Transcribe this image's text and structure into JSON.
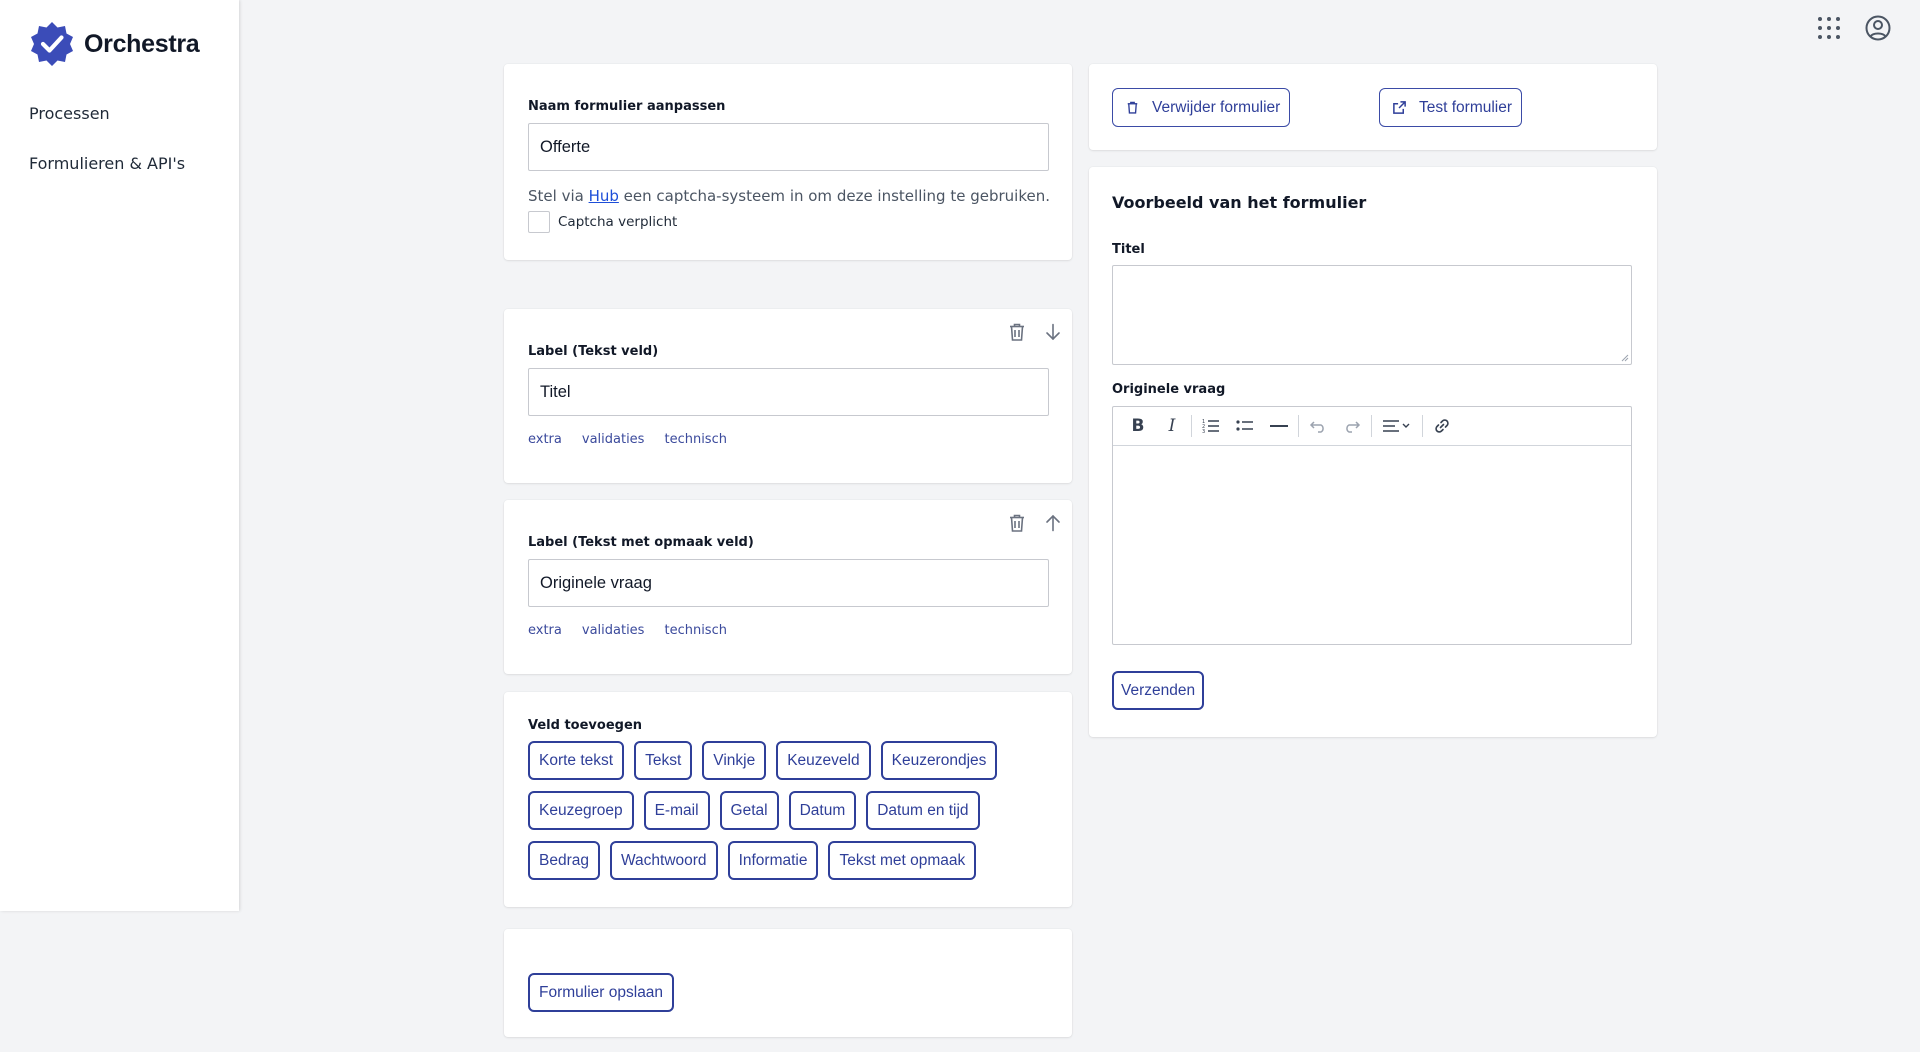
{
  "app": {
    "name": "Orchestra",
    "brand_color": "#3b4cb8"
  },
  "sidebar": {
    "items": [
      {
        "label": "Processen"
      },
      {
        "label": "Formulieren & API's"
      }
    ]
  },
  "topbar": {
    "icons": [
      "apps-grid-icon",
      "account-circle-icon"
    ]
  },
  "form_name_card": {
    "label": "Naam formulier aanpassen",
    "value": "Offerte",
    "hint_before": "Stel via ",
    "hint_link": "Hub",
    "hint_after": " een captcha-systeem in om deze instelling te gebruiken.",
    "captcha_label": "Captcha verplicht",
    "captcha_checked": false
  },
  "fields": [
    {
      "label": "Label (Tekst veld)",
      "value": "Titel",
      "links": [
        "extra",
        "validaties",
        "technisch"
      ],
      "move_icon": "arrow-down-icon"
    },
    {
      "label": "Label (Tekst met opmaak veld)",
      "value": "Originele vraag",
      "links": [
        "extra",
        "validaties",
        "technisch"
      ],
      "move_icon": "arrow-up-icon"
    }
  ],
  "add_field": {
    "title": "Veld toevoegen",
    "buttons": [
      "Korte tekst",
      "Tekst",
      "Vinkje",
      "Keuzeveld",
      "Keuzerondjes",
      "Keuzegroep",
      "E-mail",
      "Getal",
      "Datum",
      "Datum en tijd",
      "Bedrag",
      "Wachtwoord",
      "Informatie",
      "Tekst met opmaak"
    ]
  },
  "save": {
    "label": "Formulier opslaan"
  },
  "actions": {
    "delete_label": "Verwijder formulier",
    "test_label": "Test formulier"
  },
  "preview": {
    "title": "Voorbeeld van het formulier",
    "field1_label": "Titel",
    "field2_label": "Originele vraag",
    "submit_label": "Verzenden",
    "toolbar": [
      "bold",
      "italic",
      "ordered-list",
      "bullet-list",
      "horizontal-rule",
      "undo",
      "redo",
      "align",
      "link"
    ]
  },
  "colors": {
    "accent": "#2f3f99",
    "link": "#3b4a9c",
    "background": "#f3f4f6"
  }
}
